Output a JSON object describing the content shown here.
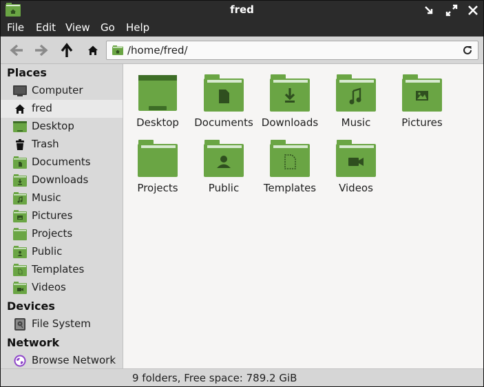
{
  "window": {
    "title": "fred"
  },
  "menu": [
    "File",
    "Edit",
    "View",
    "Go",
    "Help"
  ],
  "location": {
    "path": "/home/fred/"
  },
  "sidebar": {
    "places_header": "Places",
    "places": [
      {
        "label": "Computer",
        "icon": "computer-icon"
      },
      {
        "label": "fred",
        "icon": "home-icon"
      },
      {
        "label": "Desktop",
        "icon": "desktop-folder-icon"
      },
      {
        "label": "Trash",
        "icon": "trash-icon"
      },
      {
        "label": "Documents",
        "icon": "documents-folder-icon"
      },
      {
        "label": "Downloads",
        "icon": "downloads-folder-icon"
      },
      {
        "label": "Music",
        "icon": "music-folder-icon"
      },
      {
        "label": "Pictures",
        "icon": "pictures-folder-icon"
      },
      {
        "label": "Projects",
        "icon": "projects-folder-icon"
      },
      {
        "label": "Public",
        "icon": "public-folder-icon"
      },
      {
        "label": "Templates",
        "icon": "templates-folder-icon"
      },
      {
        "label": "Videos",
        "icon": "videos-folder-icon"
      }
    ],
    "devices_header": "Devices",
    "devices": [
      {
        "label": "File System",
        "icon": "drive-icon"
      }
    ],
    "network_header": "Network",
    "network": [
      {
        "label": "Browse Network",
        "icon": "network-icon"
      }
    ]
  },
  "files": [
    {
      "label": "Desktop",
      "icon": "desktop-folder-icon"
    },
    {
      "label": "Documents",
      "icon": "documents-folder-icon"
    },
    {
      "label": "Downloads",
      "icon": "downloads-folder-icon"
    },
    {
      "label": "Music",
      "icon": "music-folder-icon"
    },
    {
      "label": "Pictures",
      "icon": "pictures-folder-icon"
    },
    {
      "label": "Projects",
      "icon": "projects-folder-icon"
    },
    {
      "label": "Public",
      "icon": "public-folder-icon"
    },
    {
      "label": "Templates",
      "icon": "templates-folder-icon"
    },
    {
      "label": "Videos",
      "icon": "videos-folder-icon"
    }
  ],
  "status": {
    "text": "9 folders, Free space: 789.2 GiB"
  },
  "colors": {
    "folder": "#6aa544",
    "folder_dark": "#3d6d26",
    "folder_tab": "#d8ead0",
    "titlebar": "#2b2b2b",
    "sidebar": "#d9d9d9",
    "main": "#f6f5f4"
  }
}
